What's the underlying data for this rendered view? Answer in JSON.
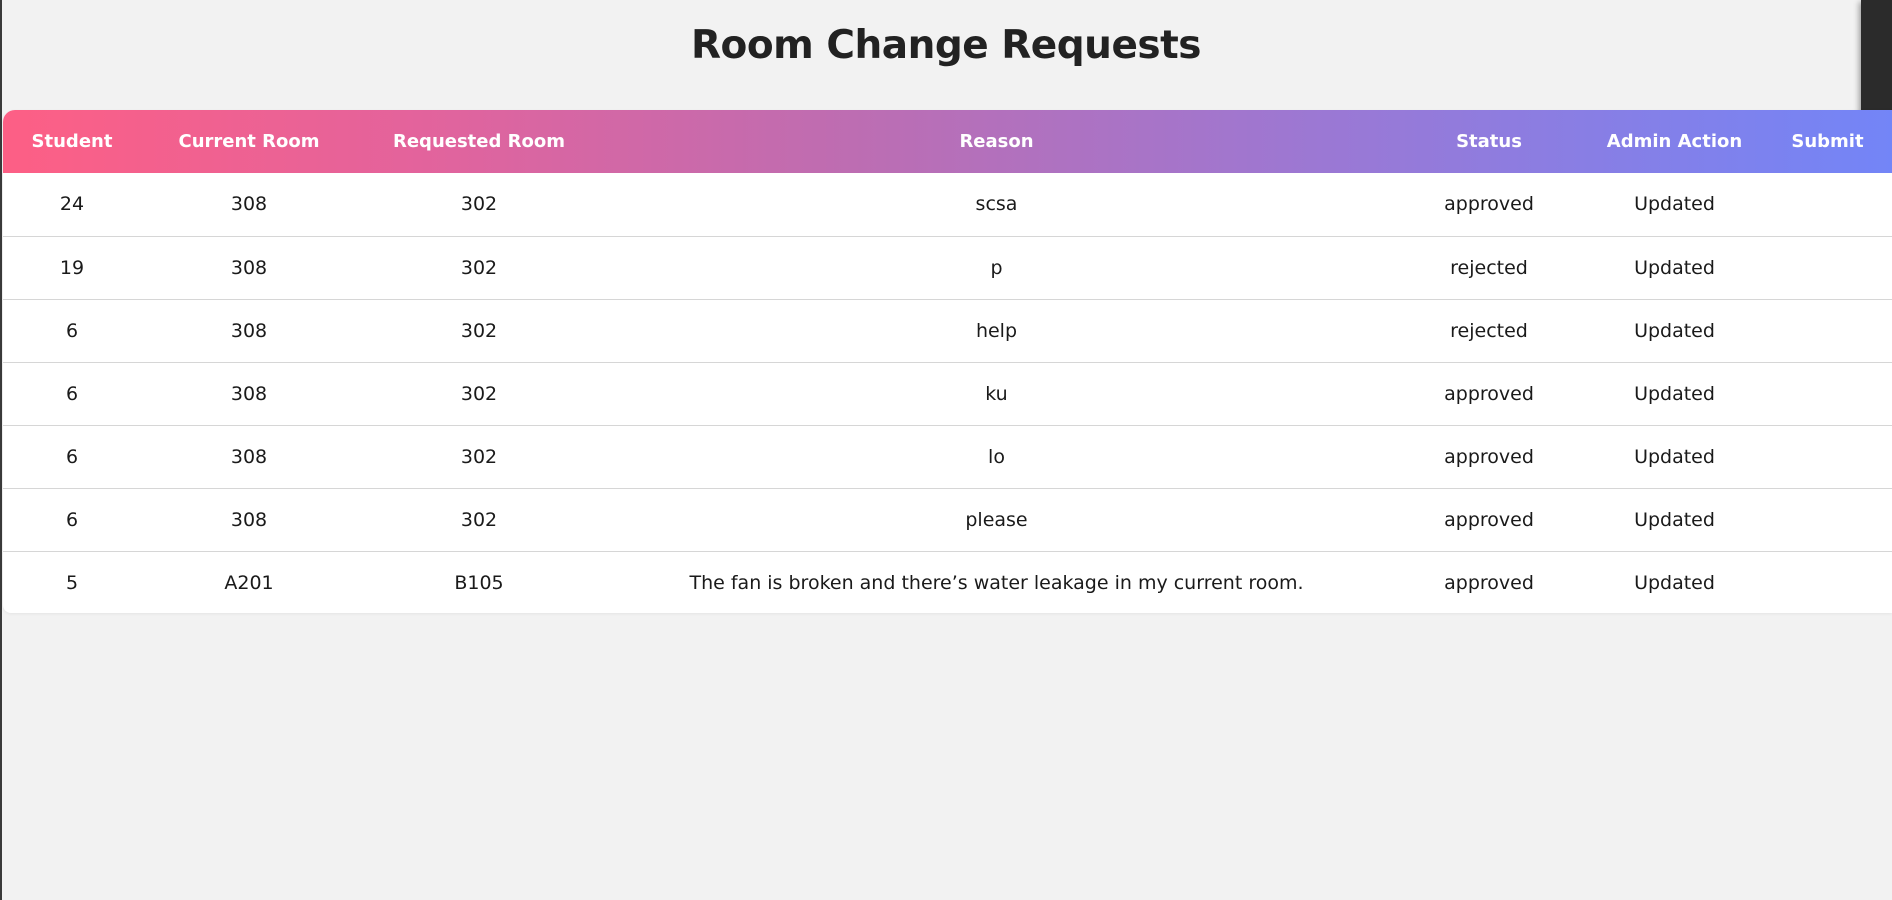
{
  "page": {
    "title": "Room Change Requests"
  },
  "table": {
    "columns": [
      "Student",
      "Current Room",
      "Requested Room",
      "Reason",
      "Status",
      "Admin Action",
      "Submit"
    ],
    "rows": [
      {
        "student": "24",
        "current_room": "308",
        "requested_room": "302",
        "reason": "scsa",
        "status": "approved",
        "admin_action": "Updated",
        "submit": ""
      },
      {
        "student": "19",
        "current_room": "308",
        "requested_room": "302",
        "reason": "p",
        "status": "rejected",
        "admin_action": "Updated",
        "submit": ""
      },
      {
        "student": "6",
        "current_room": "308",
        "requested_room": "302",
        "reason": "help",
        "status": "rejected",
        "admin_action": "Updated",
        "submit": ""
      },
      {
        "student": "6",
        "current_room": "308",
        "requested_room": "302",
        "reason": "ku",
        "status": "approved",
        "admin_action": "Updated",
        "submit": ""
      },
      {
        "student": "6",
        "current_room": "308",
        "requested_room": "302",
        "reason": "lo",
        "status": "approved",
        "admin_action": "Updated",
        "submit": ""
      },
      {
        "student": "6",
        "current_room": "308",
        "requested_room": "302",
        "reason": "please",
        "status": "approved",
        "admin_action": "Updated",
        "submit": ""
      },
      {
        "student": "5",
        "current_room": "A201",
        "requested_room": "B105",
        "reason": "The fan is broken and there’s water leakage in my current room.",
        "status": "approved",
        "admin_action": "Updated",
        "submit": ""
      }
    ]
  },
  "colors": {
    "header_gradient_start": "#fd5f85",
    "header_gradient_end": "#7385f7",
    "background": "#f2f2f2"
  }
}
